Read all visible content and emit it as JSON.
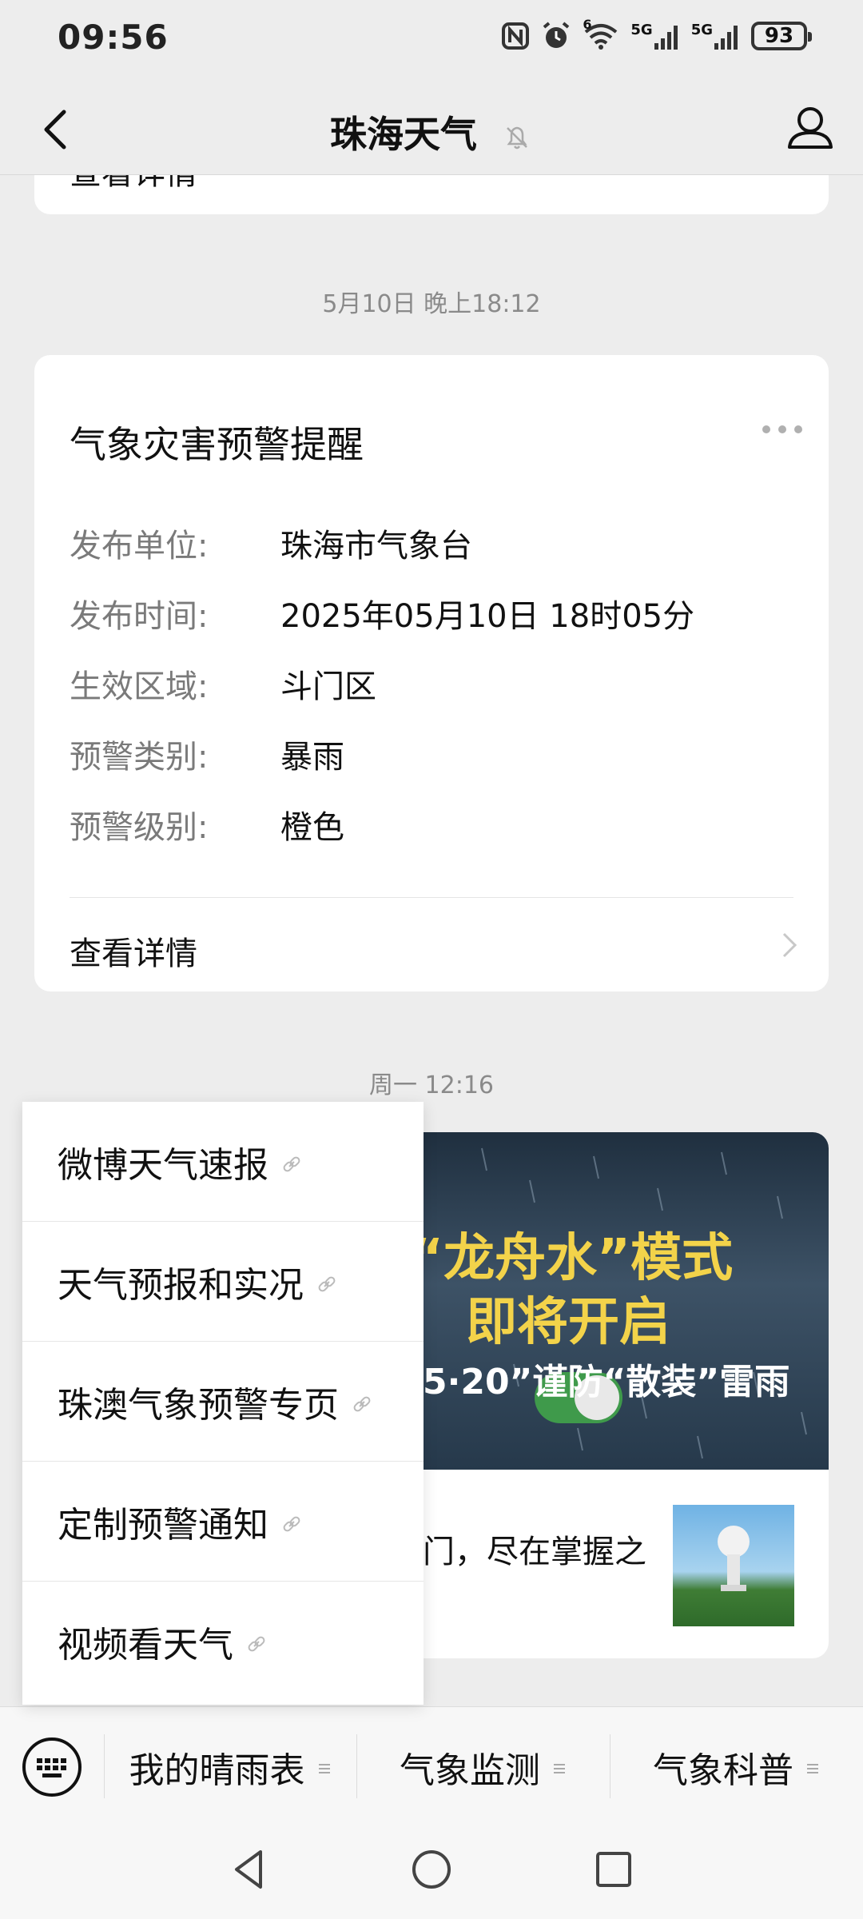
{
  "status_bar": {
    "time": "09:56",
    "battery": "93",
    "net1": "5G",
    "net2": "5G",
    "wifi_tag": "6"
  },
  "header": {
    "title": "珠海天气"
  },
  "prev_card": {
    "link_label": "查看详情"
  },
  "card": {
    "timestamp": "5月10日 晚上18:12",
    "title": "气象灾害预警提醒",
    "rows": [
      {
        "label": "发布单位:",
        "value": "珠海市气象台"
      },
      {
        "label": "发布时间:",
        "value": "2025年05月10日 18时05分"
      },
      {
        "label": "生效区域:",
        "value": "斗门区"
      },
      {
        "label": "预警类别:",
        "value": "暴雨"
      },
      {
        "label": "预警级别:",
        "value": "橙色"
      }
    ],
    "link_label": "查看详情"
  },
  "article": {
    "timestamp": "周一 12:16",
    "banner_line1": "“龙舟水”模式",
    "banner_line2": "即将开启",
    "banner_line3": "5·20”谨防“散装”雷雨",
    "snippet": "门，尽在掌握之"
  },
  "popup_menu": {
    "items": [
      {
        "label": "微博天气速报"
      },
      {
        "label": "天气预报和实况"
      },
      {
        "label": "珠澳气象预警专页"
      },
      {
        "label": "定制预警通知"
      },
      {
        "label": "视频看天气"
      }
    ]
  },
  "bottom_menu": {
    "items": [
      {
        "label": "我的晴雨表"
      },
      {
        "label": "气象监测"
      },
      {
        "label": "气象科普"
      }
    ]
  },
  "icons": {
    "back": "chevron-left-icon",
    "mute": "bell-off-icon",
    "profile": "person-icon",
    "more": "ellipsis-icon",
    "keyboard": "keyboard-icon",
    "link": "link-icon",
    "menu_lines": "menu-lines-icon"
  }
}
